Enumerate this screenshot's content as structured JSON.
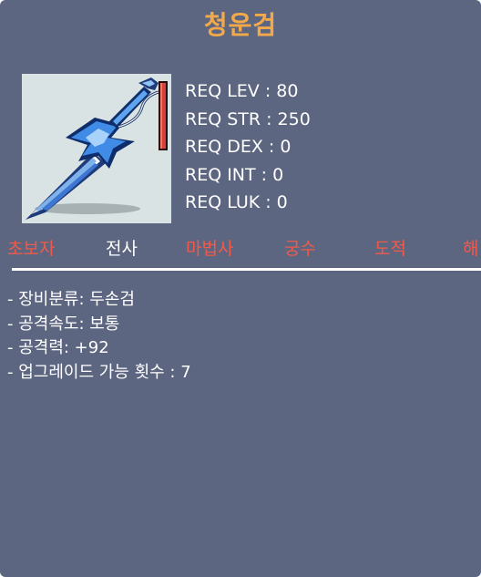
{
  "item": {
    "name": "청운검",
    "icon": "sword-icon"
  },
  "requirements": [
    "REQ LEV : 80",
    "REQ STR : 250",
    "REQ DEX : 0",
    "REQ INT : 0",
    "REQ LUK : 0"
  ],
  "jobs": [
    {
      "label": "초보자",
      "active": false
    },
    {
      "label": "전사",
      "active": true
    },
    {
      "label": "마법사",
      "active": false
    },
    {
      "label": "궁수",
      "active": false
    },
    {
      "label": "도적",
      "active": false
    },
    {
      "label": "해",
      "active": false
    }
  ],
  "description": [
    "- 장비분류: 두손검",
    "- 공격속도: 보통",
    "- 공격력: +92",
    "- 업그레이드 가능 횟수 : 7"
  ],
  "colors": {
    "panel": "#5d6681",
    "title": "#f3a94a",
    "job_inactive": "#f05a4a",
    "job_active": "#ffffff"
  }
}
